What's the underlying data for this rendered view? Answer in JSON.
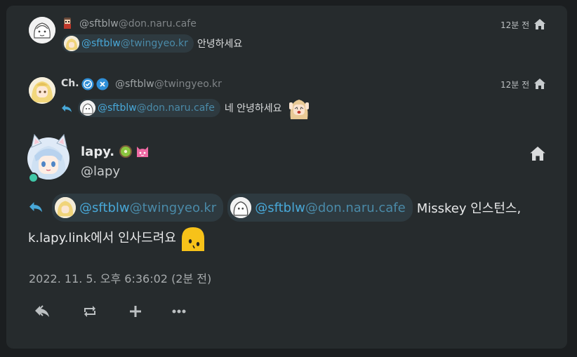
{
  "reply1": {
    "handle_user": "@sftblw",
    "handle_host": "@don.naru.cafe",
    "time": "12분 전",
    "mention_user": "@sftblw",
    "mention_host": "@twingyeo.kr",
    "text": "안녕하세요"
  },
  "reply2": {
    "name": "Ch.",
    "handle_user": "@sftblw",
    "handle_host": "@twingyeo.kr",
    "time": "12분 전",
    "mention_user": "@sftblw",
    "mention_host": "@don.naru.cafe",
    "text": "네 안녕하세요"
  },
  "main": {
    "name": "lapy.",
    "handle": "@lapy",
    "mention1_user": "@sftblw",
    "mention1_host": "@twingyeo.kr",
    "mention2_user": "@sftblw",
    "mention2_host": "@don.naru.cafe",
    "text1": "Misskey 인스턴스,",
    "text2": "k.lapy.link에서 인사드려요",
    "timestamp": "2022. 11. 5. 오후 6:36:02 (2분 전)"
  },
  "icons": {
    "home": "home-icon",
    "reply": "reply-icon",
    "renote": "renote-icon",
    "react": "plus-icon",
    "more": "more-icon",
    "verified": "verified-icon"
  },
  "colors": {
    "background": "#1b1e20",
    "card": "#262b2d",
    "accent": "#48a8d8",
    "mention_bg": "#2e3a40",
    "online": "#3fc7a8"
  }
}
